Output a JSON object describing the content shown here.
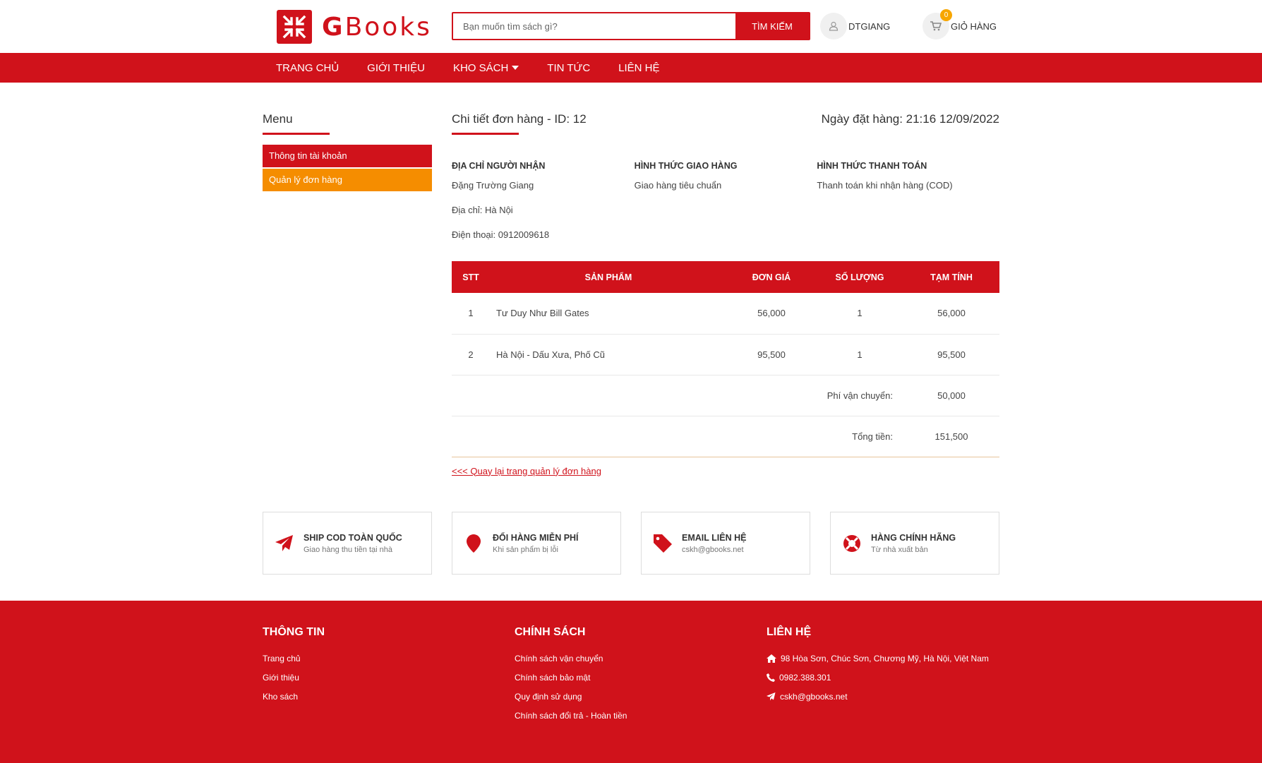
{
  "brand": {
    "name_first": "G",
    "name_rest": "Books",
    "color": "#d0121b"
  },
  "header": {
    "search_placeholder": "Bạn muốn tìm sách gì?",
    "search_button": "TÌM KIẾM",
    "user_label": "DTGIANG",
    "cart_label": "GIỎ HÀNG",
    "cart_count": "0"
  },
  "nav": [
    "TRANG CHỦ",
    "GIỚI THIỆU",
    "KHO SÁCH",
    "TIN TỨC",
    "LIÊN HỆ"
  ],
  "sidebar": {
    "title": "Menu",
    "items": [
      {
        "label": "Thông tin tài khoản",
        "color": "#d0121b"
      },
      {
        "label": "Quản lý đơn hàng",
        "color": "#f58d00"
      }
    ]
  },
  "order": {
    "title": "Chi tiết đơn hàng - ID: 12",
    "date": "Ngày đặt hàng: 21:16 12/09/2022",
    "recipient_heading": "ĐỊA CHỈ NGƯỜI NHẬN",
    "recipient_name": "Đặng Trường Giang",
    "recipient_address": "Địa chỉ: Hà Nội",
    "recipient_phone": "Điện thoại: 0912009618",
    "shipping_heading": "HÌNH THỨC GIAO HÀNG",
    "shipping_method": "Giao hàng tiêu chuẩn",
    "payment_heading": "HÌNH THỨC THANH TOÁN",
    "payment_method": "Thanh toán khi nhận hàng (COD)",
    "columns": [
      "STT",
      "SẢN PHẨM",
      "ĐƠN GIÁ",
      "SỐ LƯỢNG",
      "TẠM TÍNH"
    ],
    "rows": [
      {
        "stt": "1",
        "product": "Tư Duy Như Bill Gates",
        "price": "56,000",
        "qty": "1",
        "subtotal": "56,000"
      },
      {
        "stt": "2",
        "product": "Hà Nội - Dấu Xưa, Phố Cũ",
        "price": "95,500",
        "qty": "1",
        "subtotal": "95,500"
      }
    ],
    "shipping_fee_label": "Phí vận chuyển:",
    "shipping_fee": "50,000",
    "total_label": "Tổng tiền:",
    "total": "151,500",
    "back_link": "<<< Quay lại trang quản lý đơn hàng"
  },
  "features": [
    {
      "icon": "paper-plane-icon",
      "title": "SHIP COD TOÀN QUỐC",
      "desc": "Giao hàng thu tiền tại nhà"
    },
    {
      "icon": "map-pin-icon",
      "title": "ĐỔI HÀNG MIỄN PHÍ",
      "desc": "Khi sản phẩm bị lỗi"
    },
    {
      "icon": "tag-icon",
      "title": "EMAIL LIÊN HỆ",
      "desc": "cskh@gbooks.net"
    },
    {
      "icon": "lifebuoy-icon",
      "title": "HÀNG CHÍNH HÃNG",
      "desc": "Từ nhà xuất bản"
    }
  ],
  "footer": {
    "info_title": "THÔNG TIN",
    "info_links": [
      "Trang chủ",
      "Giới thiệu",
      "Kho sách"
    ],
    "policy_title": "CHÍNH SÁCH",
    "policy_links": [
      "Chính sách vận chuyển",
      "Chính sách bảo mật",
      "Quy định sử dụng",
      "Chính sách đổi trả - Hoàn tiền"
    ],
    "contact_title": "LIÊN HỆ",
    "address": "98 Hòa Sơn, Chúc Sơn, Chương Mỹ, Hà Nội, Việt Nam",
    "phone": "0982.388.301",
    "email": "cskh@gbooks.net"
  }
}
